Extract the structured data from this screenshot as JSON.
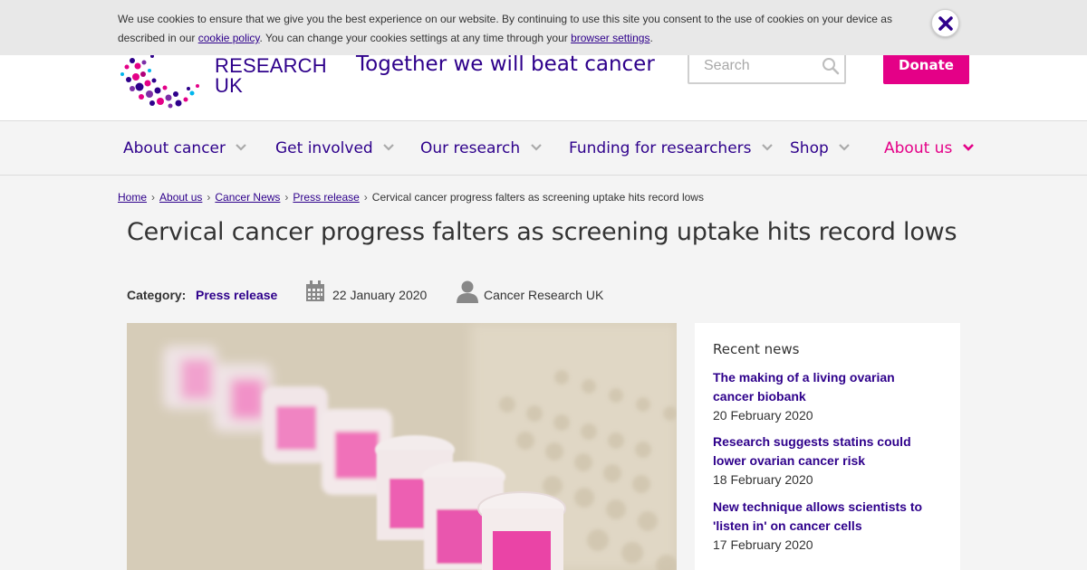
{
  "cookie": {
    "text_1": "We use cookies to ensure that we give you the best experience on our website. By continuing to use this site you consent to the use of cookies on your device as described in our ",
    "link_1": "cookie policy",
    "text_2": ". You can change your cookies settings at any time through your ",
    "link_2": "browser settings",
    "text_3": "."
  },
  "header": {
    "logo_line_1": "RESEARCH",
    "logo_line_2": "UK",
    "tagline": "Together we will beat cancer",
    "search_placeholder": "Search",
    "donate_label": "Donate"
  },
  "nav": {
    "items": [
      {
        "label": "About cancer"
      },
      {
        "label": "Get involved"
      },
      {
        "label": "Our research"
      },
      {
        "label": "Funding for researchers"
      },
      {
        "label": "Shop"
      },
      {
        "label": "About us"
      }
    ]
  },
  "breadcrumb": {
    "items": [
      "Home",
      "About us",
      "Cancer News",
      "Press release"
    ],
    "current": "Cervical cancer progress falters as screening uptake hits record lows"
  },
  "article": {
    "title": "Cervical cancer progress falters as screening uptake hits record lows",
    "category_label": "Category:",
    "category_value": "Press release",
    "date": "22 January 2020",
    "author": "Cancer Research UK"
  },
  "sidebar": {
    "title": "Recent news",
    "items": [
      {
        "title_line_1": "The making of a living ovarian",
        "title_line_2": "cancer biobank",
        "date": "20 February 2020"
      },
      {
        "title_line_1": "Research suggests statins could",
        "title_line_2": "lower ovarian cancer risk",
        "date": "18 February 2020"
      },
      {
        "title_line_1": "New technique allows scientists to",
        "title_line_2": "'listen in' on cancer cells",
        "date": "17 February 2020"
      }
    ]
  },
  "colors": {
    "brand_purple": "#2e008b",
    "brand_pink": "#e40087"
  }
}
